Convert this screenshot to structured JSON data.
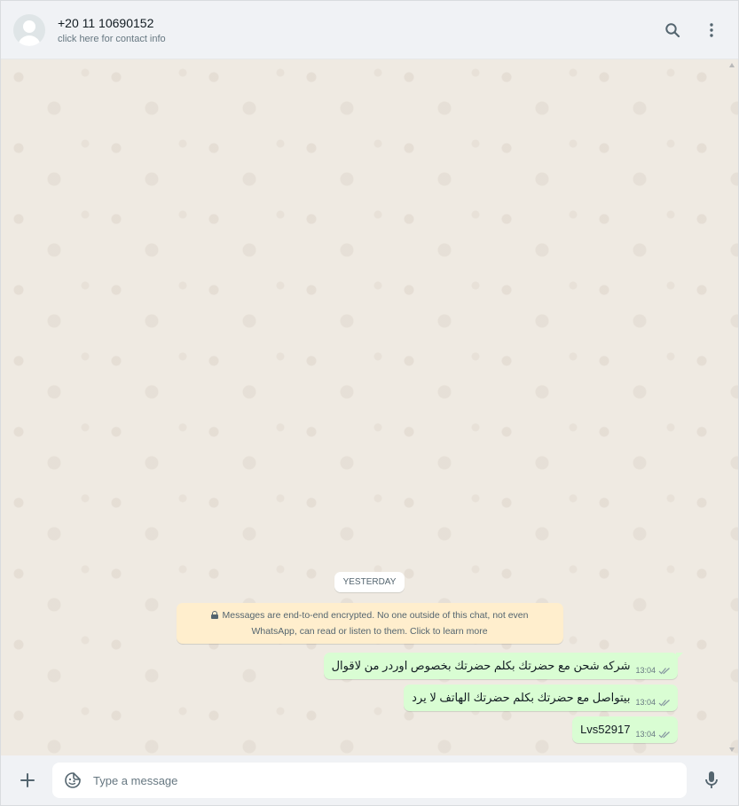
{
  "header": {
    "contact_name": "+20 11 10690152",
    "contact_subtitle": "click here for contact info",
    "avatar_icon": "default-avatar-icon",
    "actions": [
      "search-icon",
      "kebab-menu-icon"
    ]
  },
  "chat": {
    "date_chip": "YESTERDAY",
    "e2e_notice_line1": "Messages are end-to-end encrypted. No one outside of this chat, not even",
    "e2e_notice_line2": "WhatsApp, can read or listen to them. Click to learn more",
    "messages": [
      {
        "text": "شركه شحن مع حضرتك بكلم حضرتك بخصوص اوردر من لاقوال",
        "time": "13:04",
        "status": "double-check"
      },
      {
        "text": "بيتواصل مع حضرتك بكلم حضرتك الهاتف لا يرد",
        "time": "13:04",
        "status": "double-check"
      },
      {
        "text": "Lvs52917",
        "time": "13:04",
        "status": "double-check"
      }
    ]
  },
  "composer": {
    "placeholder": "Type a message",
    "attach_icon": "plus-icon",
    "sticker_icon": "sticker-icon",
    "mic_icon": "microphone-icon"
  },
  "colors": {
    "header_bg": "#f0f2f5",
    "chat_bg": "#efeae2",
    "outgoing_bubble": "#d9fdd3",
    "e2e_bg": "#ffeecd"
  }
}
